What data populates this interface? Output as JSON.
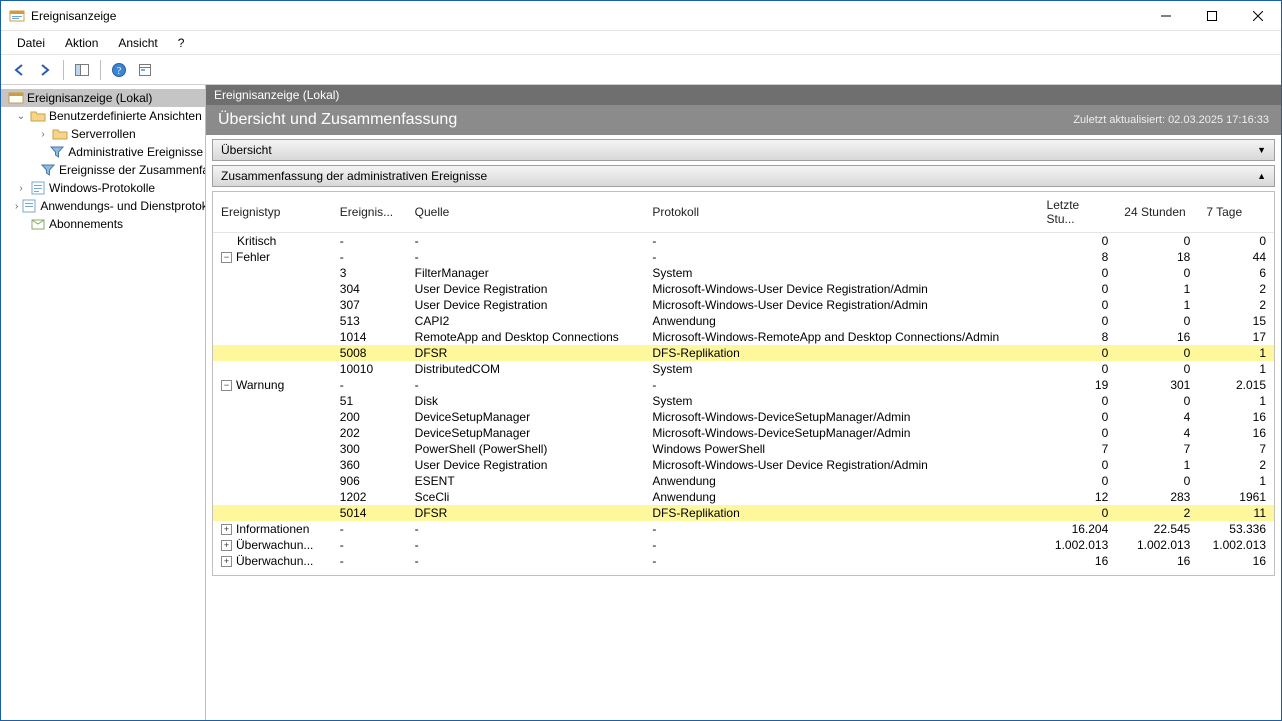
{
  "window": {
    "title": "Ereignisanzeige"
  },
  "menu": {
    "datei": "Datei",
    "aktion": "Aktion",
    "ansicht": "Ansicht",
    "help": "?"
  },
  "tree": {
    "root": "Ereignisanzeige (Lokal)",
    "custom": "Benutzerdefinierte Ansichten",
    "serverrollen": "Serverrollen",
    "admin": "Administrative Ereignisse",
    "summary": "Ereignisse der Zusammenfassung",
    "winlogs": "Windows-Protokolle",
    "applogs": "Anwendungs- und Dienstprotokolle",
    "abos": "Abonnements"
  },
  "main": {
    "hdr_dark": "Ereignisanzeige (Lokal)",
    "hdr_big": "Übersicht und Zusammenfassung",
    "ts_label": "Zuletzt aktualisiert: 02.03.2025 17:16:33",
    "sect_overview": "Übersicht",
    "sect_summary": "Zusammenfassung der administrativen Ereignisse"
  },
  "cols": {
    "type": "Ereignistyp",
    "id": "Ereignis...",
    "src": "Quelle",
    "log": "Protokoll",
    "hour": "Letzte Stu...",
    "day": "24 Stunden",
    "week": "7 Tage"
  },
  "rows": [
    {
      "type": "Kritisch",
      "exp": "",
      "id": "-",
      "src": "-",
      "log": "-",
      "h": "0",
      "d": "0",
      "w": "0",
      "hl": false
    },
    {
      "type": "Fehler",
      "exp": "−",
      "id": "-",
      "src": "-",
      "log": "-",
      "h": "8",
      "d": "18",
      "w": "44",
      "hl": false
    },
    {
      "type": "",
      "exp": "",
      "id": "3",
      "src": "FilterManager",
      "log": "System",
      "h": "0",
      "d": "0",
      "w": "6",
      "hl": false
    },
    {
      "type": "",
      "exp": "",
      "id": "304",
      "src": "User Device Registration",
      "log": "Microsoft-Windows-User Device Registration/Admin",
      "h": "0",
      "d": "1",
      "w": "2",
      "hl": false
    },
    {
      "type": "",
      "exp": "",
      "id": "307",
      "src": "User Device Registration",
      "log": "Microsoft-Windows-User Device Registration/Admin",
      "h": "0",
      "d": "1",
      "w": "2",
      "hl": false
    },
    {
      "type": "",
      "exp": "",
      "id": "513",
      "src": "CAPI2",
      "log": "Anwendung",
      "h": "0",
      "d": "0",
      "w": "15",
      "hl": false
    },
    {
      "type": "",
      "exp": "",
      "id": "1014",
      "src": "RemoteApp and Desktop Connections",
      "log": "Microsoft-Windows-RemoteApp and Desktop Connections/Admin",
      "h": "8",
      "d": "16",
      "w": "17",
      "hl": false
    },
    {
      "type": "",
      "exp": "",
      "id": "5008",
      "src": "DFSR",
      "log": "DFS-Replikation",
      "h": "0",
      "d": "0",
      "w": "1",
      "hl": true
    },
    {
      "type": "",
      "exp": "",
      "id": "10010",
      "src": "DistributedCOM",
      "log": "System",
      "h": "0",
      "d": "0",
      "w": "1",
      "hl": false
    },
    {
      "type": "Warnung",
      "exp": "−",
      "id": "-",
      "src": "-",
      "log": "-",
      "h": "19",
      "d": "301",
      "w": "2.015",
      "hl": false
    },
    {
      "type": "",
      "exp": "",
      "id": "51",
      "src": "Disk",
      "log": "System",
      "h": "0",
      "d": "0",
      "w": "1",
      "hl": false
    },
    {
      "type": "",
      "exp": "",
      "id": "200",
      "src": "DeviceSetupManager",
      "log": "Microsoft-Windows-DeviceSetupManager/Admin",
      "h": "0",
      "d": "4",
      "w": "16",
      "hl": false
    },
    {
      "type": "",
      "exp": "",
      "id": "202",
      "src": "DeviceSetupManager",
      "log": "Microsoft-Windows-DeviceSetupManager/Admin",
      "h": "0",
      "d": "4",
      "w": "16",
      "hl": false
    },
    {
      "type": "",
      "exp": "",
      "id": "300",
      "src": "PowerShell (PowerShell)",
      "log": "Windows PowerShell",
      "h": "7",
      "d": "7",
      "w": "7",
      "hl": false
    },
    {
      "type": "",
      "exp": "",
      "id": "360",
      "src": "User Device Registration",
      "log": "Microsoft-Windows-User Device Registration/Admin",
      "h": "0",
      "d": "1",
      "w": "2",
      "hl": false
    },
    {
      "type": "",
      "exp": "",
      "id": "906",
      "src": "ESENT",
      "log": "Anwendung",
      "h": "0",
      "d": "0",
      "w": "1",
      "hl": false
    },
    {
      "type": "",
      "exp": "",
      "id": "1202",
      "src": "SceCli",
      "log": "Anwendung",
      "h": "12",
      "d": "283",
      "w": "1961",
      "hl": false
    },
    {
      "type": "",
      "exp": "",
      "id": "5014",
      "src": "DFSR",
      "log": "DFS-Replikation",
      "h": "0",
      "d": "2",
      "w": "11",
      "hl": true
    },
    {
      "type": "Informationen",
      "exp": "+",
      "id": "-",
      "src": "-",
      "log": "-",
      "h": "16.204",
      "d": "22.545",
      "w": "53.336",
      "hl": false
    },
    {
      "type": "Überwachun...",
      "exp": "+",
      "id": "-",
      "src": "-",
      "log": "-",
      "h": "1.002.013",
      "d": "1.002.013",
      "w": "1.002.013",
      "hl": false
    },
    {
      "type": "Überwachun...",
      "exp": "+",
      "id": "-",
      "src": "-",
      "log": "-",
      "h": "16",
      "d": "16",
      "w": "16",
      "hl": false
    }
  ]
}
